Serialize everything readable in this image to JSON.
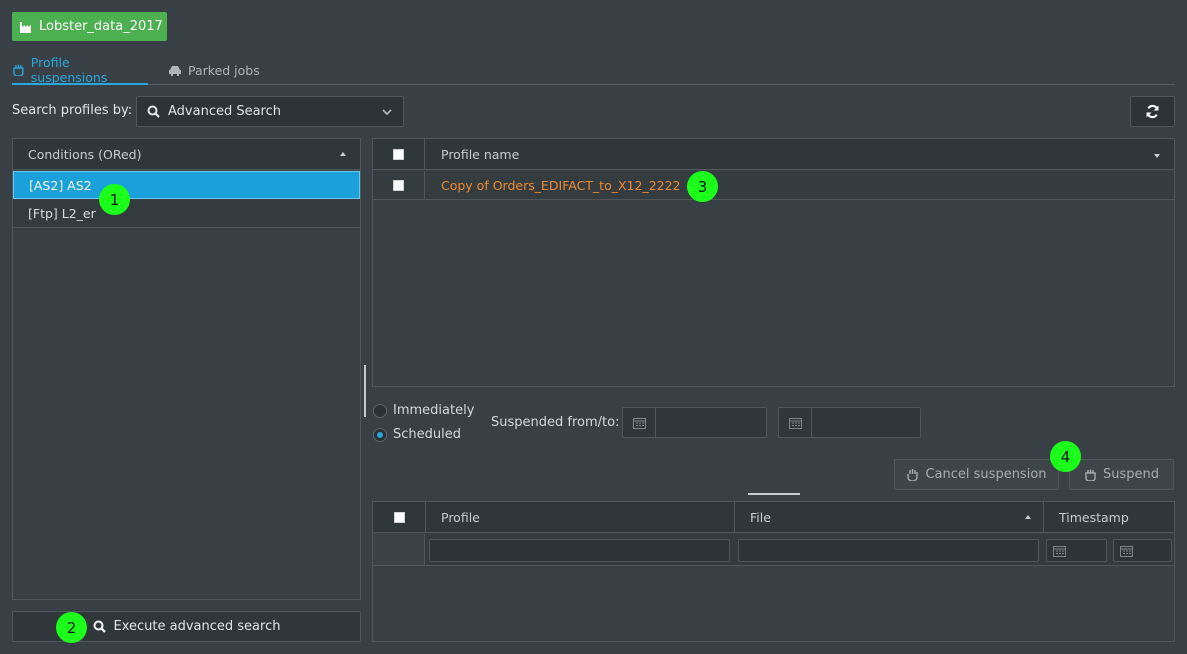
{
  "app": {
    "title": "Lobster_data_2017"
  },
  "tabs": [
    {
      "label": "Profile suspensions",
      "active": true
    },
    {
      "label": "Parked jobs",
      "active": false
    }
  ],
  "search": {
    "label": "Search profiles by:",
    "selected": "Advanced Search"
  },
  "conditions": {
    "header": "Conditions (ORed)",
    "items": [
      "[AS2] AS2",
      "[Ftp] L2_er"
    ]
  },
  "execute_label": "Execute advanced search",
  "profiles": {
    "header": "Profile name",
    "rows": [
      {
        "name": "Copy of Orders_EDIFACT_to_X12_2222"
      }
    ]
  },
  "timing": {
    "immediately_label": "Immediately",
    "scheduled_label": "Scheduled",
    "selected": "Scheduled",
    "suspended_label": "Suspended from/to:"
  },
  "actions": {
    "cancel_label": "Cancel suspension",
    "suspend_label": "Suspend"
  },
  "jobs": {
    "columns": [
      "Profile",
      "File",
      "Timestamp"
    ]
  },
  "badges": [
    "1",
    "2",
    "3",
    "4"
  ],
  "colors": {
    "accent": "#1aa1dc",
    "brand": "#4caf50",
    "link": "#ef8a2c",
    "badge": "#1bff1b"
  }
}
